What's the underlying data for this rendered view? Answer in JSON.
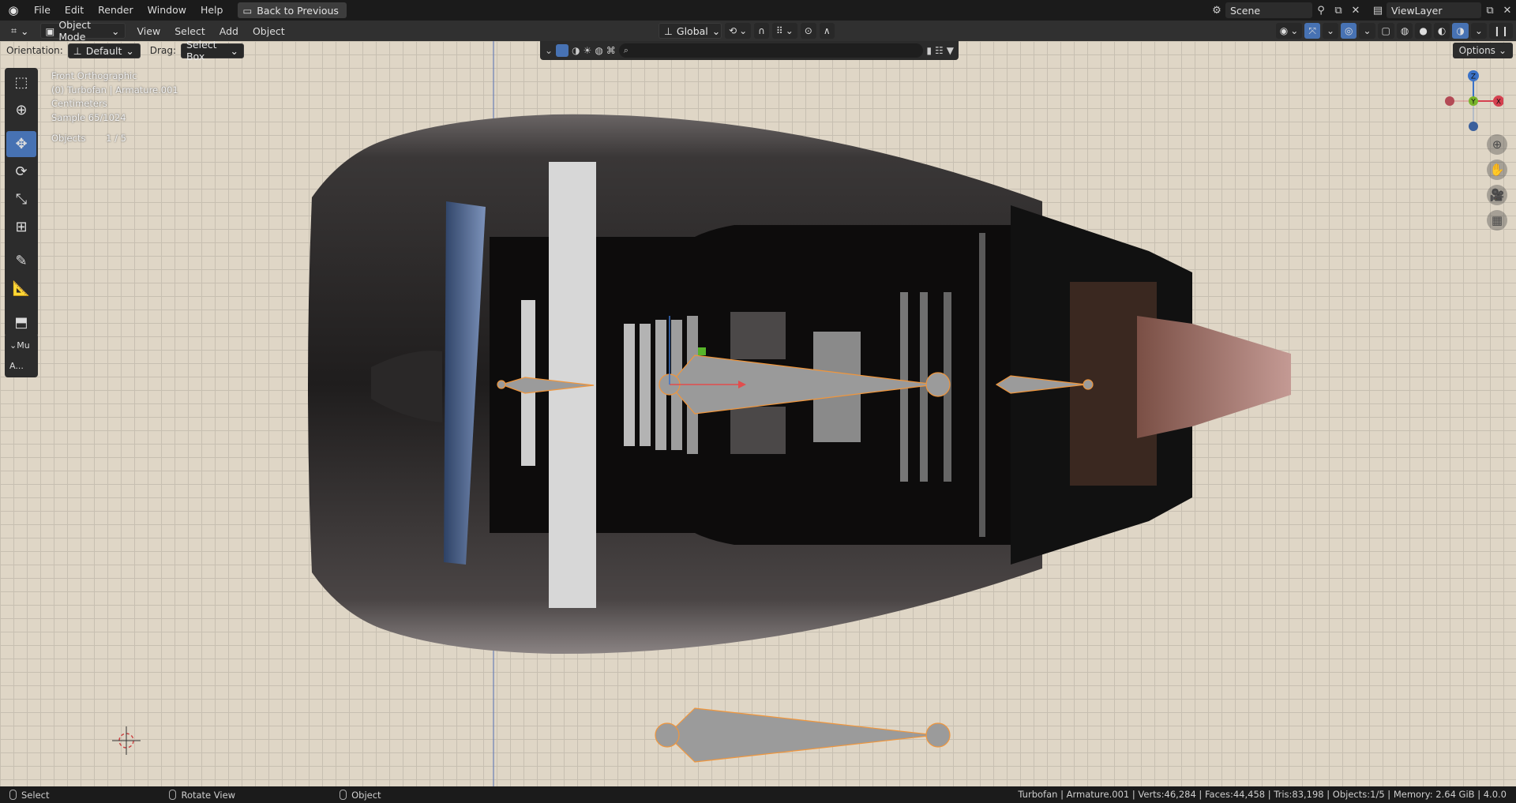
{
  "menubar": {
    "items": [
      "File",
      "Edit",
      "Render",
      "Window",
      "Help"
    ],
    "back_label": "Back to Previous",
    "scene": "Scene",
    "view_layer": "ViewLayer"
  },
  "header": {
    "mode": "Object Mode",
    "menus": [
      "View",
      "Select",
      "Add",
      "Object"
    ],
    "transform_orientation": "Global"
  },
  "toolsettings": {
    "orientation_label": "Orientation:",
    "orientation_value": "Default",
    "drag_label": "Drag:",
    "drag_value": "Select Box",
    "options_label": "Options"
  },
  "sidebar_panel": {
    "tab_1": "Mu",
    "tab_2": "A..."
  },
  "viewport_info": {
    "view_name": "Front Orthographic",
    "object_info": "(0) Turbofan | Armature.001",
    "units": "Centimeters",
    "sample": "Sample 65/1024",
    "objects_label": "Objects",
    "objects_value": "1 / 5"
  },
  "gizmo": {
    "x": "X",
    "y": "Y",
    "z": "Z"
  },
  "statusbar": {
    "select": "Select",
    "rotate_view": "Rotate View",
    "object": "Object",
    "stats": "Turbofan | Armature.001 | Verts:46,284 | Faces:44,458 | Tris:83,198 | Objects:1/5 | Memory: 2.64 GiB | 4.0.0"
  },
  "colors": {
    "accent": "#4772b3",
    "selection_outline": "#f0963c",
    "axis_x": "#d5404f",
    "axis_y": "#79b52a",
    "axis_z": "#3a72c8"
  }
}
